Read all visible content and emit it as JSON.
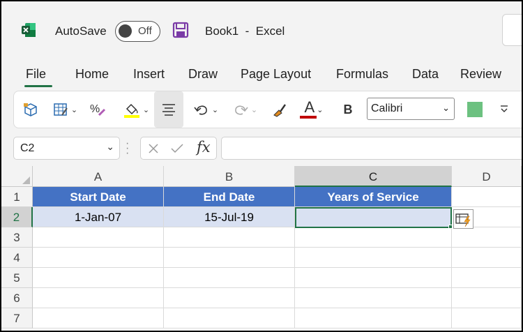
{
  "titlebar": {
    "autosave_label": "AutoSave",
    "autosave_state": "Off",
    "book_title": "Book1  -  Excel"
  },
  "menu": {
    "tabs": [
      "File",
      "Home",
      "Insert",
      "Draw",
      "Page Layout",
      "Formulas",
      "Data",
      "Review"
    ]
  },
  "ribbon": {
    "font_name": "Calibri",
    "bold_label": "B",
    "font_color_letter": "A",
    "fill_color": "#ffff00",
    "font_color": "#c00000",
    "swatch_color": "#6cc180"
  },
  "formula_bar": {
    "name_box": "C2",
    "fx_label": "fx",
    "formula": ""
  },
  "sheet": {
    "columns": [
      "A",
      "B",
      "C",
      "D"
    ],
    "rows": [
      "1",
      "2",
      "3",
      "4",
      "5",
      "6",
      "7"
    ],
    "selected_cell": "C2",
    "header_row": [
      "Start Date",
      "End Date",
      "Years of Service"
    ],
    "data_row": [
      "1-Jan-07",
      "15-Jul-19",
      ""
    ],
    "header_fill": "#4472c4",
    "data_fill": "#d9e1f2"
  }
}
